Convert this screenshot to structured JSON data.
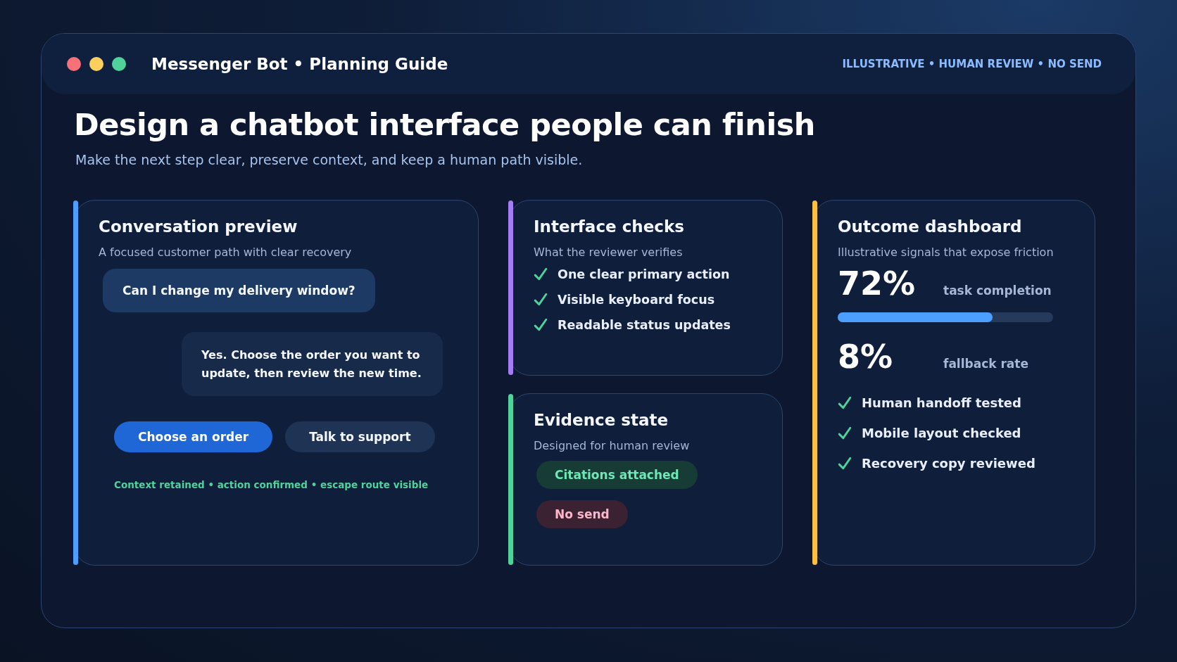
{
  "window": {
    "dots": [
      {
        "color": "#f87179"
      },
      {
        "color": "#fdd05e"
      },
      {
        "color": "#4fd39b"
      }
    ],
    "title": "Messenger Bot • Planning Guide",
    "tag": "ILLUSTRATIVE • HUMAN REVIEW • NO SEND"
  },
  "heading": "Design a chatbot interface people can finish",
  "subheading": "Make the next step clear, preserve context, and keep a human path visible.",
  "conversation": {
    "title": "Conversation preview",
    "subtitle": "A focused customer path with clear recovery",
    "color": "#4c9ffe",
    "messages": [
      {
        "kind": "user",
        "text": "Can I change my delivery window?"
      },
      {
        "kind": "bot",
        "text": "Yes. Choose the order you want to update, then review the new time."
      }
    ],
    "actions": [
      {
        "label": "Choose an order",
        "kind": "primary"
      },
      {
        "label": "Talk to support",
        "kind": "secondary"
      }
    ],
    "footnote": "Context retained • action confirmed • escape route visible"
  },
  "checks": {
    "title": "Interface checks",
    "subtitle": "What the reviewer verifies",
    "color": "#a67cf5",
    "items": [
      {
        "label": "One clear primary action",
        "checked": true
      },
      {
        "label": "Visible keyboard focus",
        "checked": true
      },
      {
        "label": "Readable status updates",
        "checked": true
      }
    ]
  },
  "evidence": {
    "title": "Evidence state",
    "subtitle": "Designed for human review",
    "color": "#4fd39b",
    "badges": [
      {
        "label": "Citations attached",
        "kind": "positive"
      },
      {
        "label": "No send",
        "kind": "negative"
      }
    ]
  },
  "dashboard": {
    "title": "Outcome dashboard",
    "subtitle": "Illustrative signals that expose friction",
    "color": "#fbbf44",
    "metrics": [
      {
        "value": "72%",
        "label": "task completion",
        "level": 0.72
      },
      {
        "value": "8%",
        "label": "fallback rate"
      }
    ],
    "items": [
      {
        "label": "Human handoff tested",
        "checked": true
      },
      {
        "label": "Mobile layout checked",
        "checked": true
      },
      {
        "label": "Recovery copy reviewed",
        "checked": true
      }
    ]
  }
}
